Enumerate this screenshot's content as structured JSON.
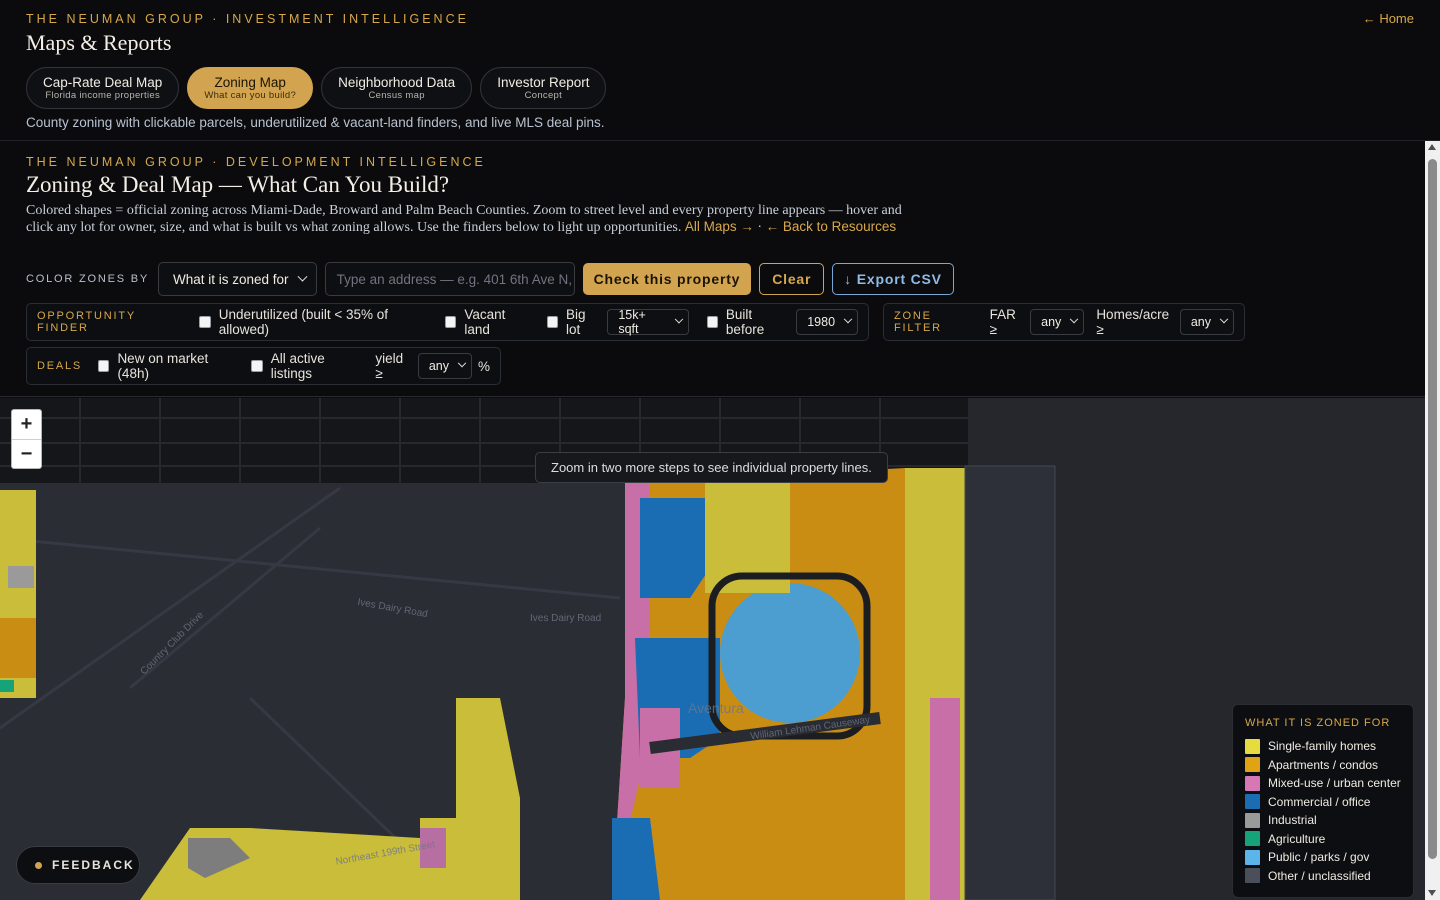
{
  "header": {
    "eyebrow": "THE NEUMAN GROUP · INVESTMENT INTELLIGENCE",
    "title": "Maps & Reports",
    "home_link": "← Home",
    "subtitle": "County zoning with clickable parcels, underutilized & vacant-land finders, and live MLS deal pins.",
    "tabs": [
      {
        "label": "Cap-Rate Deal Map",
        "sub": "Florida income properties",
        "active": false
      },
      {
        "label": "Zoning Map",
        "sub": "What can you build?",
        "active": true
      },
      {
        "label": "Neighborhood Data",
        "sub": "Census map",
        "active": false
      },
      {
        "label": "Investor Report",
        "sub": "Concept",
        "active": false
      }
    ]
  },
  "tool": {
    "eyebrow": "THE NEUMAN GROUP · DEVELOPMENT INTELLIGENCE",
    "title": "Zoning & Deal Map — What Can You Build?",
    "description": "Colored shapes = official zoning across Miami-Dade, Broward and Palm Beach Counties. Zoom to street level and every property line appears — hover and click any lot for owner, size, and what is built vs what zoning allows. Use the finders below to light up opportunities.",
    "all_maps_link": "All Maps →",
    "separator": " · ",
    "back_link": "← Back to Resources",
    "color_zones_label": "COLOR ZONES BY",
    "color_zones_value": "What it is zoned for",
    "address_placeholder": "Type an address — e.g. 401 6th Ave N, ...",
    "check_button": "Check this property",
    "clear_button": "Clear",
    "export_button": "↓ Export CSV",
    "opportunity": {
      "label": "OPPORTUNITY FINDER",
      "underutilized": "Underutilized (built < 35% of allowed)",
      "vacant": "Vacant land",
      "big_lot": "Big lot",
      "big_lot_value": "15k+ sqft",
      "built_before": "Built before",
      "built_before_value": "1980"
    },
    "zone_filter": {
      "label": "ZONE FILTER",
      "far": "FAR ≥",
      "far_value": "any",
      "homes": "Homes/acre ≥",
      "homes_value": "any"
    },
    "deals": {
      "label": "DEALS",
      "new_market": "New on market (48h)",
      "all_active": "All active listings",
      "yield": "yield ≥",
      "yield_value": "any",
      "pct": "%"
    }
  },
  "map": {
    "zoom_in": "+",
    "zoom_out": "−",
    "hint": "Zoom in two more steps to see individual property lines.",
    "street_labels": [
      "Ives Dairy Road",
      "Ives Dairy Road",
      "Aventura",
      "Northeast 199th Street",
      "Country Club Drive",
      "William Lehman Causeway"
    ],
    "legend": {
      "title": "WHAT IT IS ZONED FOR",
      "items": [
        {
          "label": "Single-family homes",
          "color": "#e6db3f"
        },
        {
          "label": "Apartments / condos",
          "color": "#e0a313"
        },
        {
          "label": "Mixed-use / urban center",
          "color": "#d678b4"
        },
        {
          "label": "Commercial / office",
          "color": "#1a6db3"
        },
        {
          "label": "Industrial",
          "color": "#9a9a9a"
        },
        {
          "label": "Agriculture",
          "color": "#16a37a"
        },
        {
          "label": "Public / parks / gov",
          "color": "#5cb5e8"
        },
        {
          "label": "Other / unclassified",
          "color": "#4a4f5a"
        }
      ]
    },
    "feedback": "FEEDBACK"
  }
}
